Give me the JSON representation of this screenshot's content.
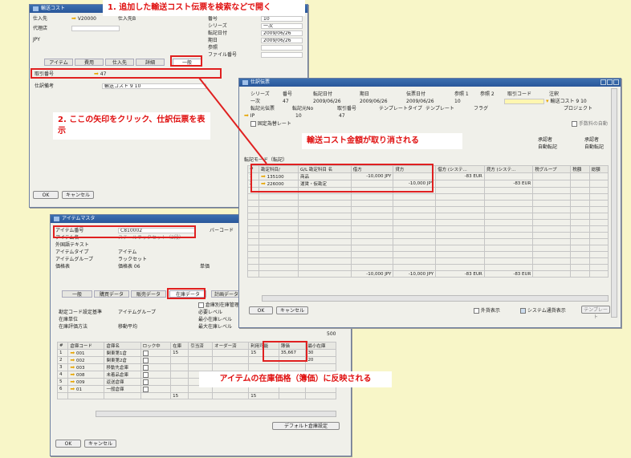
{
  "callouts": {
    "c1": "1. 追加した輸送コスト伝票を検索などで開く",
    "c2": "2. ここの矢印をクリック、仕訳伝票を表示",
    "c3": "輸送コスト金額が取り消される",
    "c4": "アイテムの在庫価格（簿価）に反映される"
  },
  "landed": {
    "title": "輸送コスト",
    "vendor_label": "仕入先",
    "vendor_code": "V20000",
    "vendor_name": "仕入先B",
    "agent_label": "代理店",
    "currency": "JPY",
    "no_label": "番号",
    "no_value": "10",
    "series_label": "シリーズ",
    "series_value": "一次",
    "posting_label": "転記日付",
    "posting_value": "2009/06/26",
    "due_label": "期日",
    "due_value": "2009/06/26",
    "ref_label": "参照",
    "file_label": "ファイル番号",
    "tabs": [
      "アイテム",
      "費用",
      "仕入先",
      "詳細",
      "一般"
    ],
    "je_label": "取引番号",
    "je_value": "47",
    "remarks_label": "仕訳備考",
    "remarks_value": "輸送コスト 9 10",
    "ok": "OK",
    "cancel": "キャンセル"
  },
  "journal": {
    "title": "仕訳伝票",
    "headers": [
      "シリーズ",
      "番号",
      "転記日付",
      "期日",
      "伝票日付",
      "参照 1",
      "参照 2",
      "取引コード",
      "注釈"
    ],
    "values": [
      "一次",
      "47",
      "2009/06/26",
      "2009/06/26",
      "2009/06/26",
      "10",
      "",
      "",
      "輸送コスト 9 10"
    ],
    "headers2": [
      "転記元伝票",
      "転記元No",
      "取引番号",
      "テンプレートタイプ",
      "テンプレート",
      "フラグ",
      "",
      "プロジェクト"
    ],
    "values2": [
      "IP",
      "10",
      "47",
      "",
      "",
      "",
      "",
      ""
    ],
    "fixed_rate": "固定為替レート",
    "auto_tax": "手数料の自動",
    "approver_label": "承認者",
    "approver_value": "自動転記",
    "reviewer_label": "承認者",
    "reviewer_value": "自動転記",
    "mode": "転記モード（転記）",
    "columns": [
      "#",
      "勘定科目/",
      "G/L 勘定科目 名",
      "借方",
      "貸方",
      "借方 (システ...",
      "貸方 (システ...",
      "税グループ",
      "税額",
      "総額"
    ],
    "rows": [
      [
        "1",
        "135100",
        "商品",
        "-10,000 JPY",
        "",
        "-83 EUR",
        "",
        "",
        "",
        ""
      ],
      [
        "2",
        "226000",
        "運賃・仮勘定",
        "",
        "-10,000 JPY",
        "",
        "-83 EUR",
        "",
        "",
        ""
      ]
    ],
    "totals": [
      "-10,000 JPY",
      "-10,000 JPY",
      "-83 EUR",
      "-83 EUR"
    ],
    "ok": "OK",
    "cancel": "キャンセル",
    "foreign_label": "外貨表示",
    "sys_label": "システム通貨表示",
    "template_btn": "テンプレート"
  },
  "item": {
    "title": "アイテムマスタ",
    "item_no_label": "アイテム番号",
    "item_no_value": "C810002",
    "barcode_label": "バーコード",
    "desc_label": "アイテム名",
    "desc_value": "スチールラックセット（2段）",
    "foreign_label": "外国語テキスト",
    "type_label": "アイテムタイプ",
    "type_value": "アイテム",
    "group_label": "アイテムグループ",
    "group_value": "ラックセット",
    "price_label": "価格表",
    "price_value": "価格表 06",
    "unit_label": "単価",
    "tabs": [
      "一般",
      "購買データ",
      "販売データ",
      "在庫データ",
      "計画データ"
    ],
    "gl_label": "勘定コード設定基準",
    "gl_value": "アイテムグループ",
    "uom_label": "在庫単位",
    "valuation_label": "在庫評価方法",
    "valuation_value": "移動平均",
    "manage_label": "倉庫別在庫管理",
    "req_label": "必要レベル",
    "min_label": "最小在庫レベル",
    "max_label": "最大在庫レベル",
    "max_value": "500",
    "columns": [
      "#",
      "倉庫コード",
      "倉庫名",
      "ロック中",
      "在庫",
      "引当済",
      "オーダー済",
      "利用可能",
      "簿価",
      "最小在庫"
    ],
    "rows": [
      [
        "1",
        "001",
        "関東第1倉",
        "",
        "15",
        "",
        "",
        "15",
        "35,667",
        "30"
      ],
      [
        "2",
        "002",
        "関東第2倉",
        "",
        "",
        "",
        "",
        "",
        "",
        "20"
      ],
      [
        "3",
        "003",
        "移動先倉庫",
        "",
        "",
        "",
        "",
        "",
        "",
        ""
      ],
      [
        "4",
        "008",
        "未着品倉庫",
        "",
        "",
        "",
        "",
        "",
        "",
        ""
      ],
      [
        "5",
        "009",
        "返送倉庫",
        "",
        "",
        "",
        "",
        "",
        "",
        ""
      ],
      [
        "6",
        "01",
        "一般倉庫",
        "",
        "",
        "",
        "",
        "",
        "",
        ""
      ]
    ],
    "total_stock": "15",
    "total_avail": "15",
    "default_wh": "デフォルト倉庫設定",
    "ok": "OK",
    "cancel": "キャンセル"
  }
}
